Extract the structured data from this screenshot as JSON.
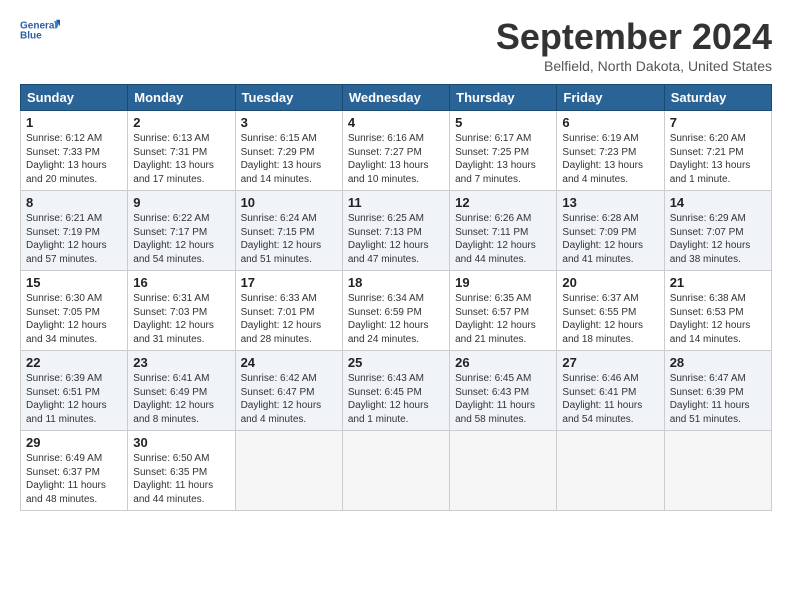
{
  "header": {
    "logo_line1": "General",
    "logo_line2": "Blue",
    "month": "September 2024",
    "location": "Belfield, North Dakota, United States"
  },
  "weekdays": [
    "Sunday",
    "Monday",
    "Tuesday",
    "Wednesday",
    "Thursday",
    "Friday",
    "Saturday"
  ],
  "weeks": [
    [
      {
        "day": "1",
        "lines": [
          "Sunrise: 6:12 AM",
          "Sunset: 7:33 PM",
          "Daylight: 13 hours",
          "and 20 minutes."
        ]
      },
      {
        "day": "2",
        "lines": [
          "Sunrise: 6:13 AM",
          "Sunset: 7:31 PM",
          "Daylight: 13 hours",
          "and 17 minutes."
        ]
      },
      {
        "day": "3",
        "lines": [
          "Sunrise: 6:15 AM",
          "Sunset: 7:29 PM",
          "Daylight: 13 hours",
          "and 14 minutes."
        ]
      },
      {
        "day": "4",
        "lines": [
          "Sunrise: 6:16 AM",
          "Sunset: 7:27 PM",
          "Daylight: 13 hours",
          "and 10 minutes."
        ]
      },
      {
        "day": "5",
        "lines": [
          "Sunrise: 6:17 AM",
          "Sunset: 7:25 PM",
          "Daylight: 13 hours",
          "and 7 minutes."
        ]
      },
      {
        "day": "6",
        "lines": [
          "Sunrise: 6:19 AM",
          "Sunset: 7:23 PM",
          "Daylight: 13 hours",
          "and 4 minutes."
        ]
      },
      {
        "day": "7",
        "lines": [
          "Sunrise: 6:20 AM",
          "Sunset: 7:21 PM",
          "Daylight: 13 hours",
          "and 1 minute."
        ]
      }
    ],
    [
      {
        "day": "8",
        "lines": [
          "Sunrise: 6:21 AM",
          "Sunset: 7:19 PM",
          "Daylight: 12 hours",
          "and 57 minutes."
        ]
      },
      {
        "day": "9",
        "lines": [
          "Sunrise: 6:22 AM",
          "Sunset: 7:17 PM",
          "Daylight: 12 hours",
          "and 54 minutes."
        ]
      },
      {
        "day": "10",
        "lines": [
          "Sunrise: 6:24 AM",
          "Sunset: 7:15 PM",
          "Daylight: 12 hours",
          "and 51 minutes."
        ]
      },
      {
        "day": "11",
        "lines": [
          "Sunrise: 6:25 AM",
          "Sunset: 7:13 PM",
          "Daylight: 12 hours",
          "and 47 minutes."
        ]
      },
      {
        "day": "12",
        "lines": [
          "Sunrise: 6:26 AM",
          "Sunset: 7:11 PM",
          "Daylight: 12 hours",
          "and 44 minutes."
        ]
      },
      {
        "day": "13",
        "lines": [
          "Sunrise: 6:28 AM",
          "Sunset: 7:09 PM",
          "Daylight: 12 hours",
          "and 41 minutes."
        ]
      },
      {
        "day": "14",
        "lines": [
          "Sunrise: 6:29 AM",
          "Sunset: 7:07 PM",
          "Daylight: 12 hours",
          "and 38 minutes."
        ]
      }
    ],
    [
      {
        "day": "15",
        "lines": [
          "Sunrise: 6:30 AM",
          "Sunset: 7:05 PM",
          "Daylight: 12 hours",
          "and 34 minutes."
        ]
      },
      {
        "day": "16",
        "lines": [
          "Sunrise: 6:31 AM",
          "Sunset: 7:03 PM",
          "Daylight: 12 hours",
          "and 31 minutes."
        ]
      },
      {
        "day": "17",
        "lines": [
          "Sunrise: 6:33 AM",
          "Sunset: 7:01 PM",
          "Daylight: 12 hours",
          "and 28 minutes."
        ]
      },
      {
        "day": "18",
        "lines": [
          "Sunrise: 6:34 AM",
          "Sunset: 6:59 PM",
          "Daylight: 12 hours",
          "and 24 minutes."
        ]
      },
      {
        "day": "19",
        "lines": [
          "Sunrise: 6:35 AM",
          "Sunset: 6:57 PM",
          "Daylight: 12 hours",
          "and 21 minutes."
        ]
      },
      {
        "day": "20",
        "lines": [
          "Sunrise: 6:37 AM",
          "Sunset: 6:55 PM",
          "Daylight: 12 hours",
          "and 18 minutes."
        ]
      },
      {
        "day": "21",
        "lines": [
          "Sunrise: 6:38 AM",
          "Sunset: 6:53 PM",
          "Daylight: 12 hours",
          "and 14 minutes."
        ]
      }
    ],
    [
      {
        "day": "22",
        "lines": [
          "Sunrise: 6:39 AM",
          "Sunset: 6:51 PM",
          "Daylight: 12 hours",
          "and 11 minutes."
        ]
      },
      {
        "day": "23",
        "lines": [
          "Sunrise: 6:41 AM",
          "Sunset: 6:49 PM",
          "Daylight: 12 hours",
          "and 8 minutes."
        ]
      },
      {
        "day": "24",
        "lines": [
          "Sunrise: 6:42 AM",
          "Sunset: 6:47 PM",
          "Daylight: 12 hours",
          "and 4 minutes."
        ]
      },
      {
        "day": "25",
        "lines": [
          "Sunrise: 6:43 AM",
          "Sunset: 6:45 PM",
          "Daylight: 12 hours",
          "and 1 minute."
        ]
      },
      {
        "day": "26",
        "lines": [
          "Sunrise: 6:45 AM",
          "Sunset: 6:43 PM",
          "Daylight: 11 hours",
          "and 58 minutes."
        ]
      },
      {
        "day": "27",
        "lines": [
          "Sunrise: 6:46 AM",
          "Sunset: 6:41 PM",
          "Daylight: 11 hours",
          "and 54 minutes."
        ]
      },
      {
        "day": "28",
        "lines": [
          "Sunrise: 6:47 AM",
          "Sunset: 6:39 PM",
          "Daylight: 11 hours",
          "and 51 minutes."
        ]
      }
    ],
    [
      {
        "day": "29",
        "lines": [
          "Sunrise: 6:49 AM",
          "Sunset: 6:37 PM",
          "Daylight: 11 hours",
          "and 48 minutes."
        ]
      },
      {
        "day": "30",
        "lines": [
          "Sunrise: 6:50 AM",
          "Sunset: 6:35 PM",
          "Daylight: 11 hours",
          "and 44 minutes."
        ]
      },
      {
        "day": "",
        "lines": []
      },
      {
        "day": "",
        "lines": []
      },
      {
        "day": "",
        "lines": []
      },
      {
        "day": "",
        "lines": []
      },
      {
        "day": "",
        "lines": []
      }
    ]
  ]
}
